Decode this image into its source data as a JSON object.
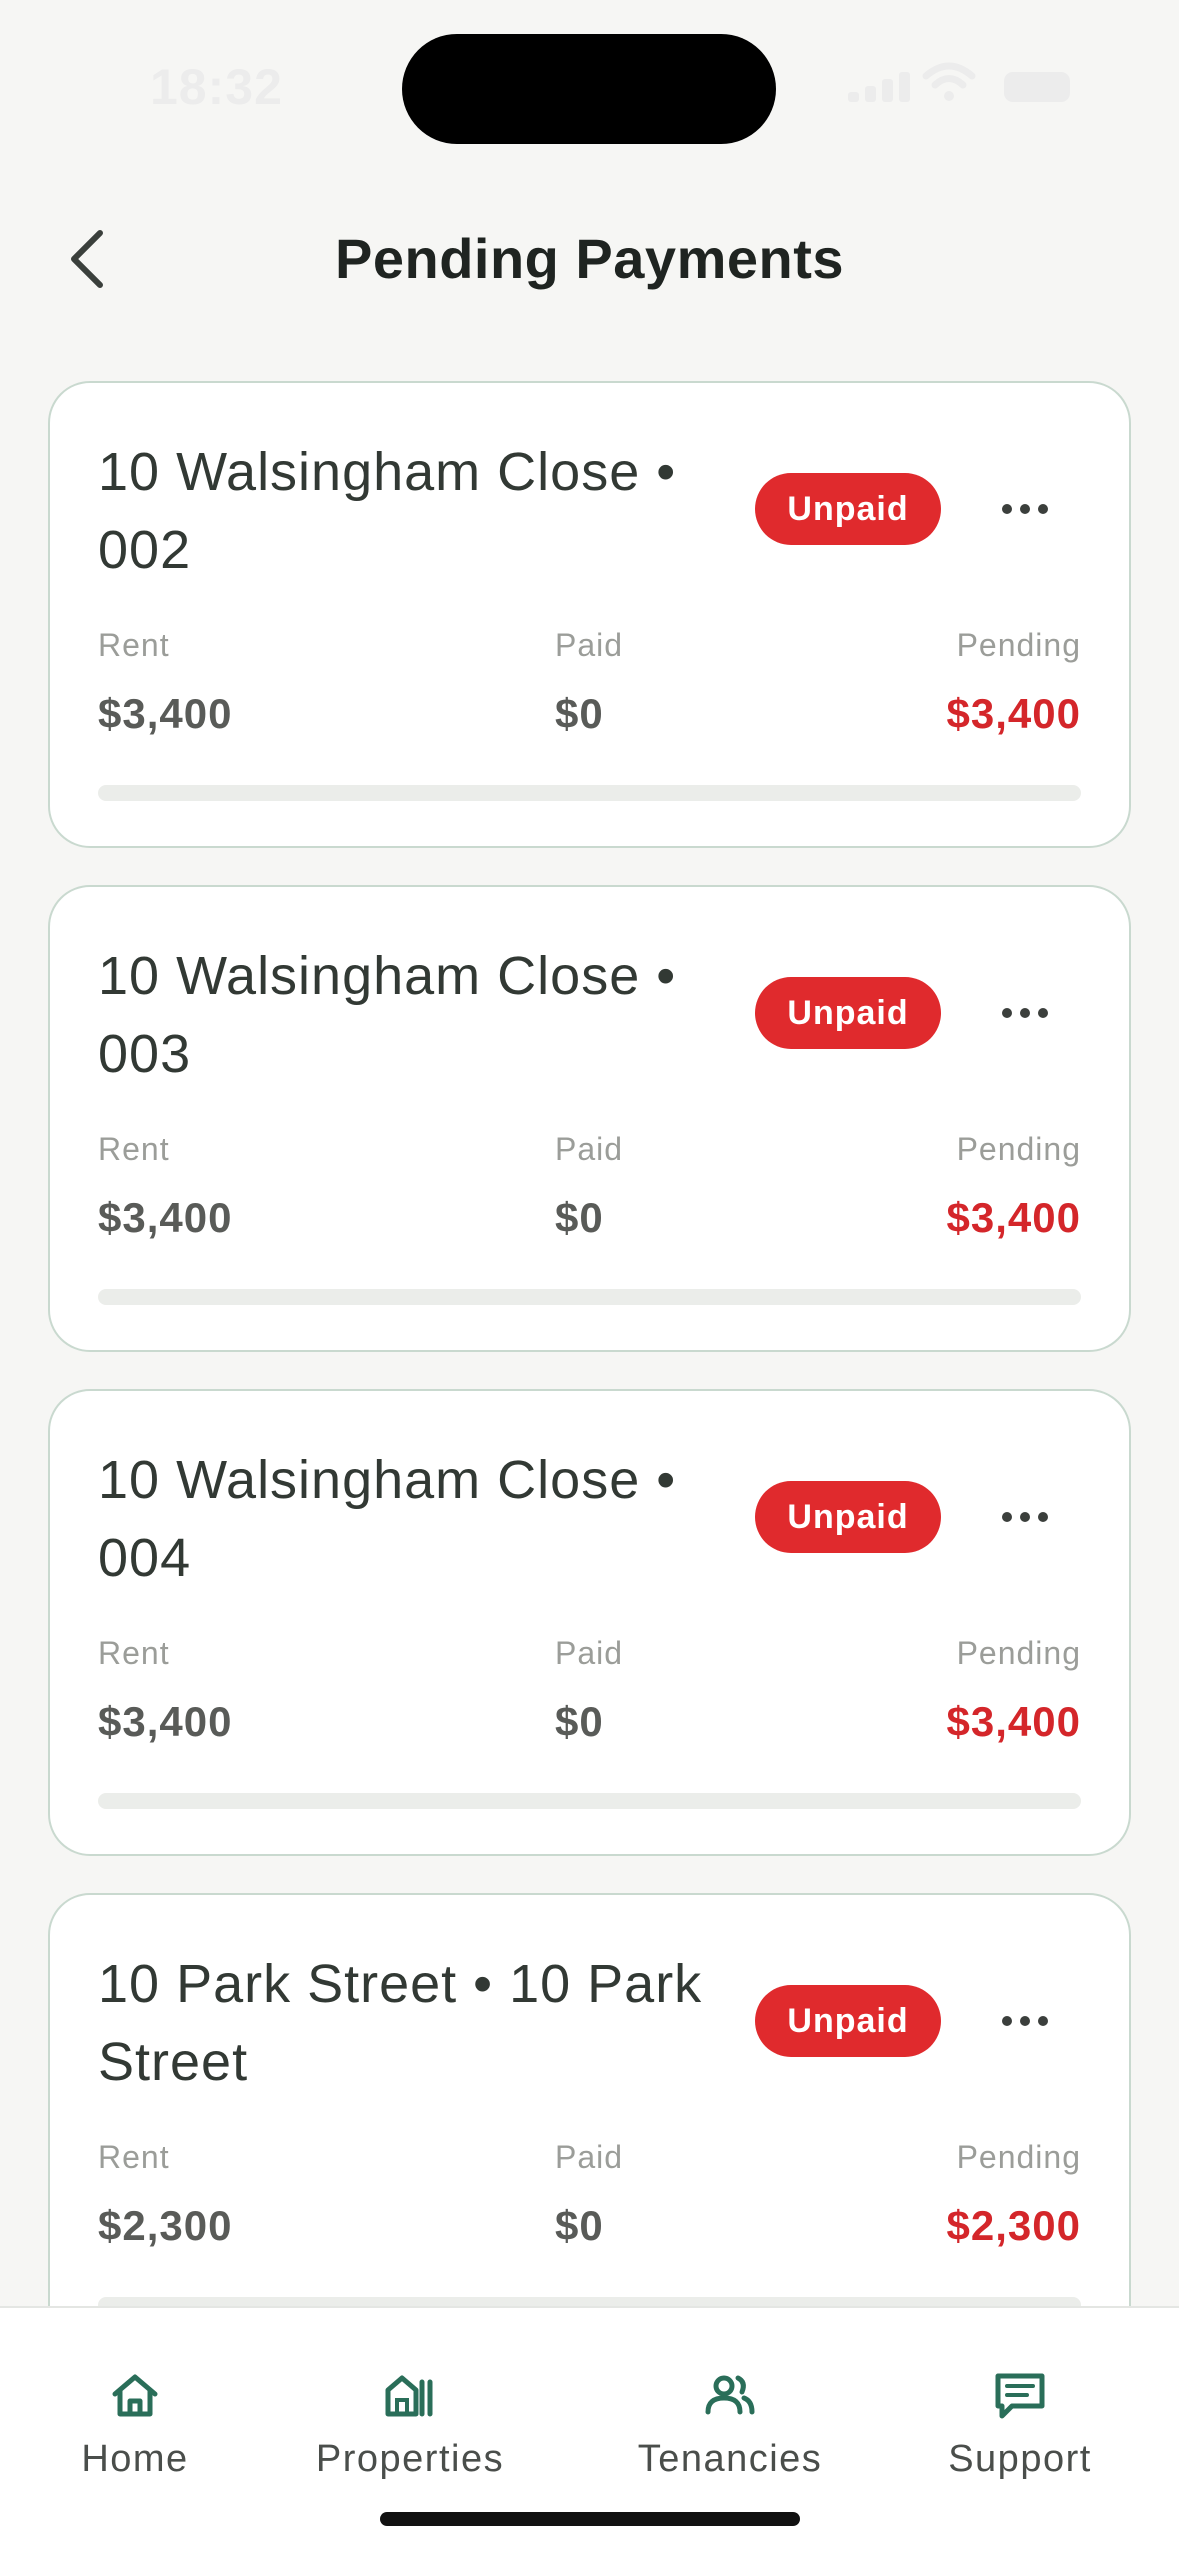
{
  "status_bar": {
    "time": "18:32"
  },
  "header": {
    "title": "Pending Payments"
  },
  "labels": {
    "rent": "Rent",
    "paid": "Paid",
    "pending": "Pending"
  },
  "payments": [
    {
      "title": "10 Walsingham Close • 002",
      "status": "Unpaid",
      "rent": "$3,400",
      "paid": "$0",
      "pending": "$3,400",
      "progress": 0
    },
    {
      "title": "10 Walsingham Close • 003",
      "status": "Unpaid",
      "rent": "$3,400",
      "paid": "$0",
      "pending": "$3,400",
      "progress": 0
    },
    {
      "title": "10 Walsingham Close • 004",
      "status": "Unpaid",
      "rent": "$3,400",
      "paid": "$0",
      "pending": "$3,400",
      "progress": 0
    },
    {
      "title": "10 Park Street • 10 Park Street",
      "status": "Unpaid",
      "rent": "$2,300",
      "paid": "$0",
      "pending": "$2,300",
      "progress": 0
    }
  ],
  "nav": {
    "items": [
      {
        "label": "Home",
        "icon": "home-icon"
      },
      {
        "label": "Properties",
        "icon": "buildings-icon"
      },
      {
        "label": "Tenancies",
        "icon": "people-icon"
      },
      {
        "label": "Support",
        "icon": "chat-icon"
      }
    ]
  },
  "colors": {
    "accent": "#2a6e59",
    "badge_unpaid": "#e02a2d",
    "pending_amount": "#d4262a",
    "background": "#f6f6f4"
  }
}
